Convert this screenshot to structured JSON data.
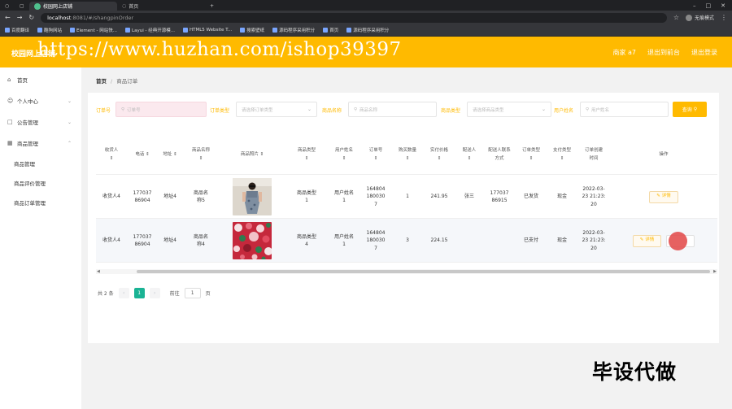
{
  "browser": {
    "tabs": [
      {
        "title": "校园网上店铺"
      },
      {
        "title": "首页"
      }
    ],
    "window_controls": [
      "–",
      "□",
      "✕"
    ],
    "url_host": "localhost",
    "url_path": ":8081/#/shangpinOrder",
    "profile": "无痕模式",
    "bookmarks": [
      "百度翻译",
      "酷狗网站",
      "Element - 网站快...",
      "Layui - 经典开源模...",
      "HTML5 Website T...",
      "搜索壁纸",
      "源码程序采用积分",
      "首页",
      "源码程序采用积分"
    ]
  },
  "header": {
    "logo": "校园网上店铺",
    "watermark": "https://www.huzhan.com/ishop39397",
    "user": "商家 a7",
    "back_link": "退出到前台",
    "logout": "退出登录",
    "accent": "#ffba00"
  },
  "sidebar": {
    "home": "首页",
    "personal": "个人中心",
    "notice": "公告管理",
    "goods": "商品管理",
    "sub": [
      "商品管理",
      "商品评价管理",
      "商品订单管理"
    ]
  },
  "breadcrumb": {
    "home": "首页",
    "current": "商品订单"
  },
  "filters": [
    {
      "label": "订单号",
      "placeholder": "订单号"
    },
    {
      "label": "订单类型",
      "placeholder": "请选择订单类型"
    },
    {
      "label": "商品名称",
      "placeholder": "商品名称"
    },
    {
      "label": "商品类型",
      "placeholder": "请选择商品类型"
    },
    {
      "label": "用户姓名",
      "placeholder": "用户姓名"
    }
  ],
  "search_btn": "查询",
  "columns": [
    "收货人",
    "电话",
    "地址",
    "商品名称",
    "商品照片",
    "商品类型",
    "用户姓名",
    "订单号",
    "购买数量",
    "实付价格",
    "配送人",
    "配送人联系方式",
    "订单类型",
    "支付类型",
    "订单创建时间",
    "操作"
  ],
  "rows": [
    {
      "receiver": "收货人4",
      "phone": "17703786904",
      "address": "地址4",
      "goods": "商品名称5",
      "type": "商品类型1",
      "user": "用户姓名1",
      "order_no": "1648041800307",
      "qty": "1",
      "price": "241.95",
      "courier": "张三",
      "courier_phone": "17703786915",
      "order_type": "已发货",
      "pay": "现金",
      "created": "2022-03-23 21:23:20",
      "detail": "详情"
    },
    {
      "receiver": "收货人4",
      "phone": "17703786904",
      "address": "地址4",
      "goods": "商品名称4",
      "type": "商品类型4",
      "user": "用户姓名1",
      "order_no": "1648041800307",
      "qty": "3",
      "price": "224.15",
      "courier": "",
      "courier_phone": "",
      "order_type": "已支付",
      "pay": "现金",
      "created": "2022-03-23 21:23:20",
      "detail": "详情"
    }
  ],
  "pagination": {
    "total": "共 2 条",
    "page": "1",
    "goto": "前往",
    "goto_value": "1",
    "unit": "页"
  },
  "overlay": "毕设代做"
}
